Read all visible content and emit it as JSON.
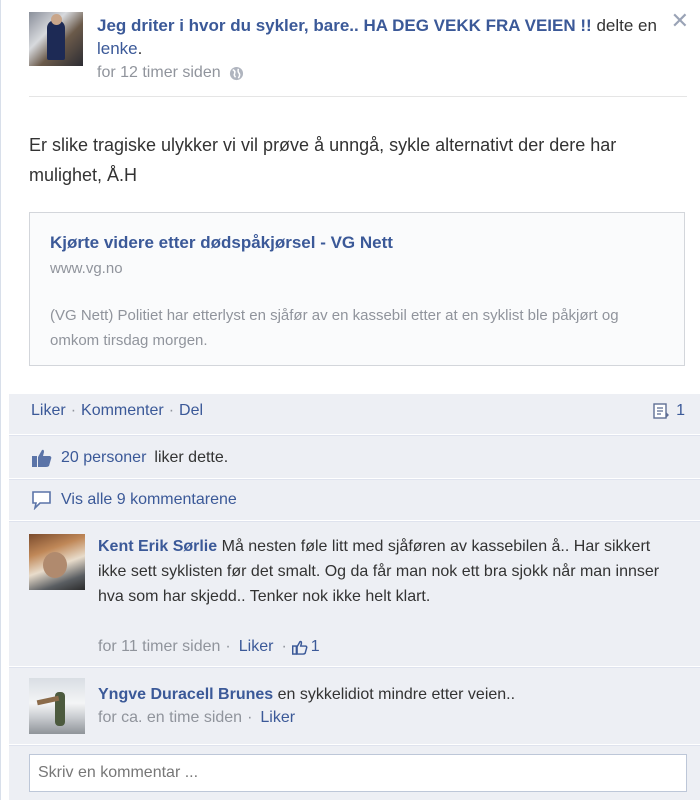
{
  "post": {
    "poster_name": "Jeg driter i hvor du sykler, bare.. HA DEG VEKK FRA VEIEN !!",
    "action_pre": "delte en",
    "action_link": "lenke",
    "action_post": ".",
    "timestamp": "for 12 timer siden",
    "close_label": "✕",
    "message": "Er slike tragiske ulykker vi vil prøve å unngå, sykle alternativt der dere har mulighet, Å.H"
  },
  "link_card": {
    "title": "Kjørte videre etter dødspåkjørsel - VG Nett",
    "domain": "www.vg.no",
    "description": "(VG Nett) Politiet har etterlyst en sjåfør av en kassebil etter at en syklist ble påkjørt og omkom tirsdag morgen."
  },
  "actions": {
    "like": "Liker",
    "comment": "Kommenter",
    "share": "Del",
    "separator": "·",
    "share_count": "1"
  },
  "likes": {
    "count_text": "20 personer",
    "suffix": "liker dette."
  },
  "view_all": "Vis alle 9 kommentarene",
  "comments": [
    {
      "name": "Kent Erik Sørlie",
      "text": "Må nesten føle litt med sjåføren av kassebilen å.. Har sikkert ikke sett syklisten før det smalt. Og da får man nok ett bra sjokk når man innser hva som har skjedd.. Tenker nok ikke helt klart.",
      "time": "for 11 timer siden",
      "like": "Liker",
      "like_count": "1"
    },
    {
      "name": "Yngve Duracell Brunes",
      "text": "en sykkelidiot mindre etter veien..",
      "time": "for ca. en time siden",
      "like": "Liker"
    }
  ],
  "comment_input": {
    "placeholder": "Skriv en kommentar ..."
  },
  "colors": {
    "link": "#3b5998",
    "meta": "#90949c",
    "feedback_bg": "#edeff4"
  }
}
